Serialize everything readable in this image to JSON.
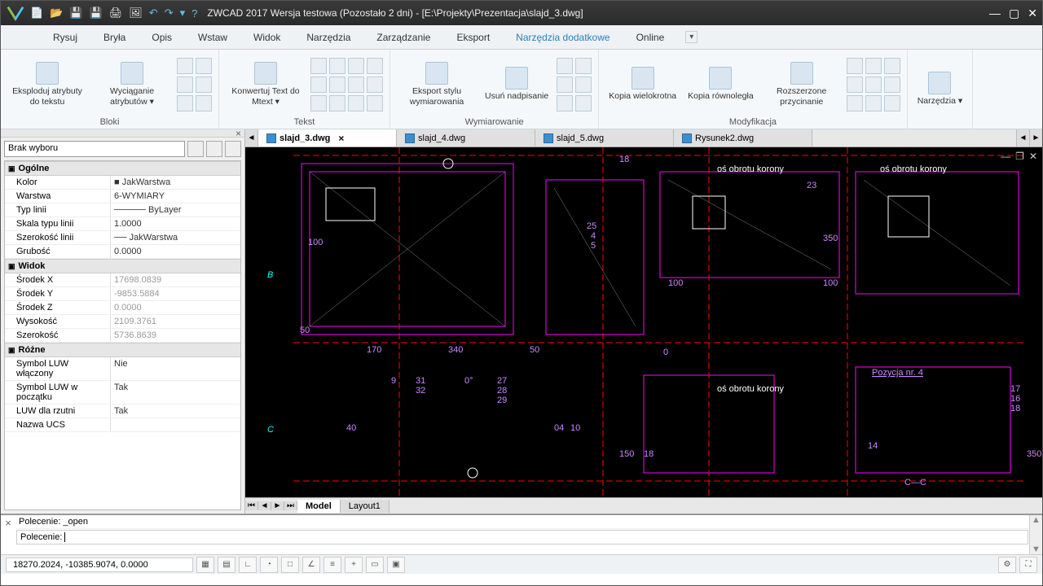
{
  "app": {
    "title": "ZWCAD 2017 Wersja testowa (Pozostało 2 dni) - [E:\\Projekty\\Prezentacja\\slajd_3.dwg]"
  },
  "menu": {
    "items": [
      "Rysuj",
      "Bryła",
      "Opis",
      "Wstaw",
      "Widok",
      "Narzędzia",
      "Zarządzanie",
      "Eksport",
      "Narzędzia dodatkowe",
      "Online"
    ],
    "active_index": 8
  },
  "ribbon": {
    "groups": [
      {
        "label": "Bloki",
        "buttons": [
          {
            "label": "Eksploduj atrybuty do tekstu"
          },
          {
            "label": "Wyciąganie atrybutów ▾"
          }
        ],
        "small_icons": 6
      },
      {
        "label": "Tekst",
        "buttons": [
          {
            "label": "Konwertuj Text do Mtext ▾"
          }
        ],
        "small_icons": 12
      },
      {
        "label": "Wymiarowanie",
        "buttons": [
          {
            "label": "Eksport stylu wymiarowania"
          },
          {
            "label": "Usuń nadpisanie"
          }
        ],
        "small_icons": 6
      },
      {
        "label": "Modyfikacja",
        "buttons": [
          {
            "label": "Kopia wielokrotna"
          },
          {
            "label": "Kopia równoległa"
          },
          {
            "label": "Rozszerzone przycinanie"
          }
        ],
        "small_icons": 9
      },
      {
        "label": "",
        "buttons": [
          {
            "label": "Narzędzia ▾"
          }
        ],
        "small_icons": 0
      }
    ]
  },
  "properties": {
    "selector": "Brak wyboru",
    "sections": [
      {
        "title": "Ogólne",
        "rows": [
          {
            "k": "Kolor",
            "v": "■ JakWarstwa"
          },
          {
            "k": "Warstwa",
            "v": "6-WYMIARY"
          },
          {
            "k": "Typ linii",
            "v": "───── ByLayer"
          },
          {
            "k": "Skala typu linii",
            "v": "1.0000"
          },
          {
            "k": "Szerokość linii",
            "v": "── JakWarstwa"
          },
          {
            "k": "Grubość",
            "v": "0.0000"
          }
        ]
      },
      {
        "title": "Widok",
        "rows": [
          {
            "k": "Środek X",
            "v": "17698.0839",
            "muted": true
          },
          {
            "k": "Środek Y",
            "v": "-9853.5884",
            "muted": true
          },
          {
            "k": "Środek Z",
            "v": "0.0000",
            "muted": true
          },
          {
            "k": "Wysokość",
            "v": "2109.3761",
            "muted": true
          },
          {
            "k": "Szerokość",
            "v": "5736.8639",
            "muted": true
          }
        ]
      },
      {
        "title": "Różne",
        "rows": [
          {
            "k": "Symbol LUW włączony",
            "v": "Nie"
          },
          {
            "k": "Symbol LUW w początku",
            "v": "Tak"
          },
          {
            "k": "LUW dla rzutni",
            "v": "Tak"
          },
          {
            "k": "Nazwa UCS",
            "v": ""
          }
        ]
      }
    ]
  },
  "doc_tabs": {
    "tabs": [
      {
        "label": "slajd_3.dwg",
        "active": true,
        "closable": true
      },
      {
        "label": "slajd_4.dwg"
      },
      {
        "label": "slajd_5.dwg"
      },
      {
        "label": "Rysunek2.dwg"
      }
    ]
  },
  "layout_tabs": {
    "tabs": [
      {
        "label": "Model",
        "active": true
      },
      {
        "label": "Layout1"
      }
    ]
  },
  "command": {
    "history": "Polecenie: _open",
    "prompt": "Polecenie: "
  },
  "status": {
    "coords": "18270.2024, -10385.9074, 0.0000"
  },
  "chart_data": {
    "type": "table",
    "note": "Architectural CAD floor plan with dimension annotations; selected visible dimension values",
    "dimensions_visible": [
      18,
      100,
      25,
      4,
      5,
      100,
      23,
      350,
      100,
      170,
      340,
      50,
      50,
      9,
      31,
      32,
      27,
      28,
      29,
      40,
      10,
      150,
      18,
      14,
      17,
      16,
      18,
      350
    ]
  }
}
